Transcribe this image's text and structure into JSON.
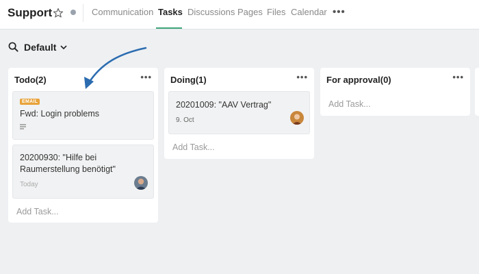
{
  "header": {
    "title": "Support",
    "tabs": [
      {
        "label": "Communication",
        "active": false
      },
      {
        "label": "Tasks",
        "active": true
      },
      {
        "label": "Discussions",
        "active": false
      },
      {
        "label": "Pages",
        "active": false
      },
      {
        "label": "Files",
        "active": false
      },
      {
        "label": "Calendar",
        "active": false
      }
    ],
    "more": "•••"
  },
  "filter": {
    "label": "Default"
  },
  "columns": [
    {
      "title": "Todo(2)",
      "more": "•••",
      "cards": [
        {
          "badge": "EMAIL",
          "title": "Fwd: Login problems",
          "has_description": true
        },
        {
          "title_line1": "20200930: \"Hilfe bei",
          "title_line2": "Raumerstellung benötigt\"",
          "date": "Today"
        }
      ],
      "add_task": "Add Task..."
    },
    {
      "title": "Doing(1)",
      "more": "•••",
      "cards": [
        {
          "title": "20201009: \"AAV Vertrag\"",
          "date": "9. Oct"
        }
      ],
      "add_task": "Add Task..."
    },
    {
      "title": "For approval(0)",
      "more": "•••",
      "add_task": "Add Task..."
    }
  ],
  "colors": {
    "accent": "#3ea67b",
    "badge": "#e8a33a",
    "annotation_arrow": "#2b6cb0"
  },
  "icons": [
    "star-icon",
    "status-dot",
    "more-icon",
    "search-icon",
    "chevron-down-icon",
    "description-icon",
    "avatar"
  ]
}
